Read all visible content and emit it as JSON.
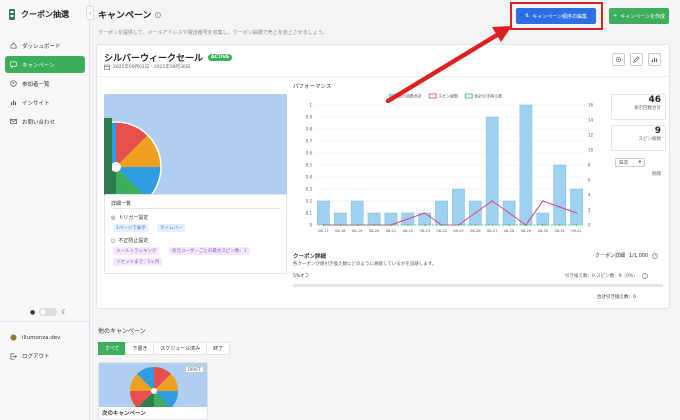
{
  "brand": {
    "title": "クーポン抽選"
  },
  "nav": [
    {
      "label": "ダッシュボード",
      "icon": "home-icon",
      "active": false
    },
    {
      "label": "キャンペーン",
      "icon": "chat-icon",
      "active": true
    },
    {
      "label": "参加者一覧",
      "icon": "users-icon",
      "active": false
    },
    {
      "label": "インサイト",
      "icon": "bar-chart-icon",
      "active": false
    },
    {
      "label": "お問い合わせ",
      "icon": "mail-icon",
      "active": false
    }
  ],
  "sidebar_footer": {
    "user": "illumonza.dev",
    "logout": "ログアウト"
  },
  "header": {
    "title": "キャンペーン",
    "subtitle": "クーポンを提供して、メールアドレスや電話番号を収集し、クーポン抽選で売上を向上させましょう。",
    "edit_order_label": "キャンペーン順序の編集",
    "create_label": "キャンペーンを作成"
  },
  "campaign": {
    "name": "シルバーウィークセール",
    "status": "ACTIVE",
    "date_range": "2025年09月01日 - 2025年09月30日",
    "details_title": "詳細一覧",
    "trigger_title": "トリガー設定",
    "trigger_chips": [
      "1ページで表示",
      "タイムバー"
    ],
    "fraud_title": "不正防止設定",
    "fraud_chips": [
      "メールトラッキング",
      "各元ユーザーごとの最大スピン数：1",
      "リセットまで：1ヶ月"
    ]
  },
  "performance": {
    "title": "パフォーマンス",
    "views_total": "46",
    "views_label": "表示回数合計",
    "spins_total": "9",
    "spins_label": "スピン総数",
    "unit_select": "日次",
    "unit_label": "期間"
  },
  "chart_data": {
    "type": "bar",
    "categories": [
      "08-17",
      "08-18",
      "08-19",
      "08-20",
      "08-21",
      "08-22",
      "08-23",
      "08-24",
      "08-25",
      "08-26",
      "08-27",
      "08-28",
      "08-29",
      "08-30",
      "08-31",
      "09-01"
    ],
    "series": [
      {
        "name": "表示回数合計",
        "type": "bar",
        "axis": "left",
        "values": [
          0.2,
          0.1,
          0.2,
          0.1,
          0.1,
          0.1,
          0.1,
          0.2,
          0.3,
          0.2,
          0.9,
          0.2,
          1.5,
          0.1,
          0.5,
          0.3
        ],
        "color": "#9fd1f0"
      },
      {
        "name": "スピン総数",
        "type": "line",
        "axis": "left",
        "values": [
          0,
          0,
          0,
          0,
          0,
          0.05,
          0.1,
          0,
          0,
          0.1,
          0.2,
          0.1,
          0,
          0.2,
          0.15,
          0.1
        ],
        "color": "#e0457b"
      },
      {
        "name": "合計引き換え数",
        "type": "line",
        "axis": "left",
        "values": [
          0,
          0,
          0,
          0,
          0,
          0,
          0,
          0,
          0,
          0,
          0,
          0,
          0,
          0,
          0,
          0
        ],
        "color": "#3cae5c"
      }
    ],
    "left_ticks": [
      "0",
      "0.1",
      "0.2",
      "0.3",
      "0.4",
      "0.5",
      "0.6",
      "0.7",
      "0.8",
      "0.9",
      "1"
    ],
    "right_ticks": [
      "0",
      "2",
      "4",
      "6",
      "8",
      "10",
      "12",
      "14",
      "16"
    ],
    "ylim": [
      0,
      1
    ],
    "legend": "top"
  },
  "coupon": {
    "title": "クーポン詳細",
    "desc": "各クーポンが幾引き換え数にどのように貢献しているかを追跡します。",
    "count": "1/1,000",
    "count_label": "クーポン詳細",
    "off_label": "5%オフ",
    "exchange_label": "引き換え数：0 スピン数：9（0%）",
    "total_exchange": "合計引き換え数：0",
    "progress": 0
  },
  "others": {
    "title": "他のキャンペーン",
    "tabs": [
      "すべて",
      "下書き",
      "スケジュール済み",
      "終了"
    ],
    "card_badge": "DRAFT",
    "card_name": "次のキャンペーン"
  }
}
